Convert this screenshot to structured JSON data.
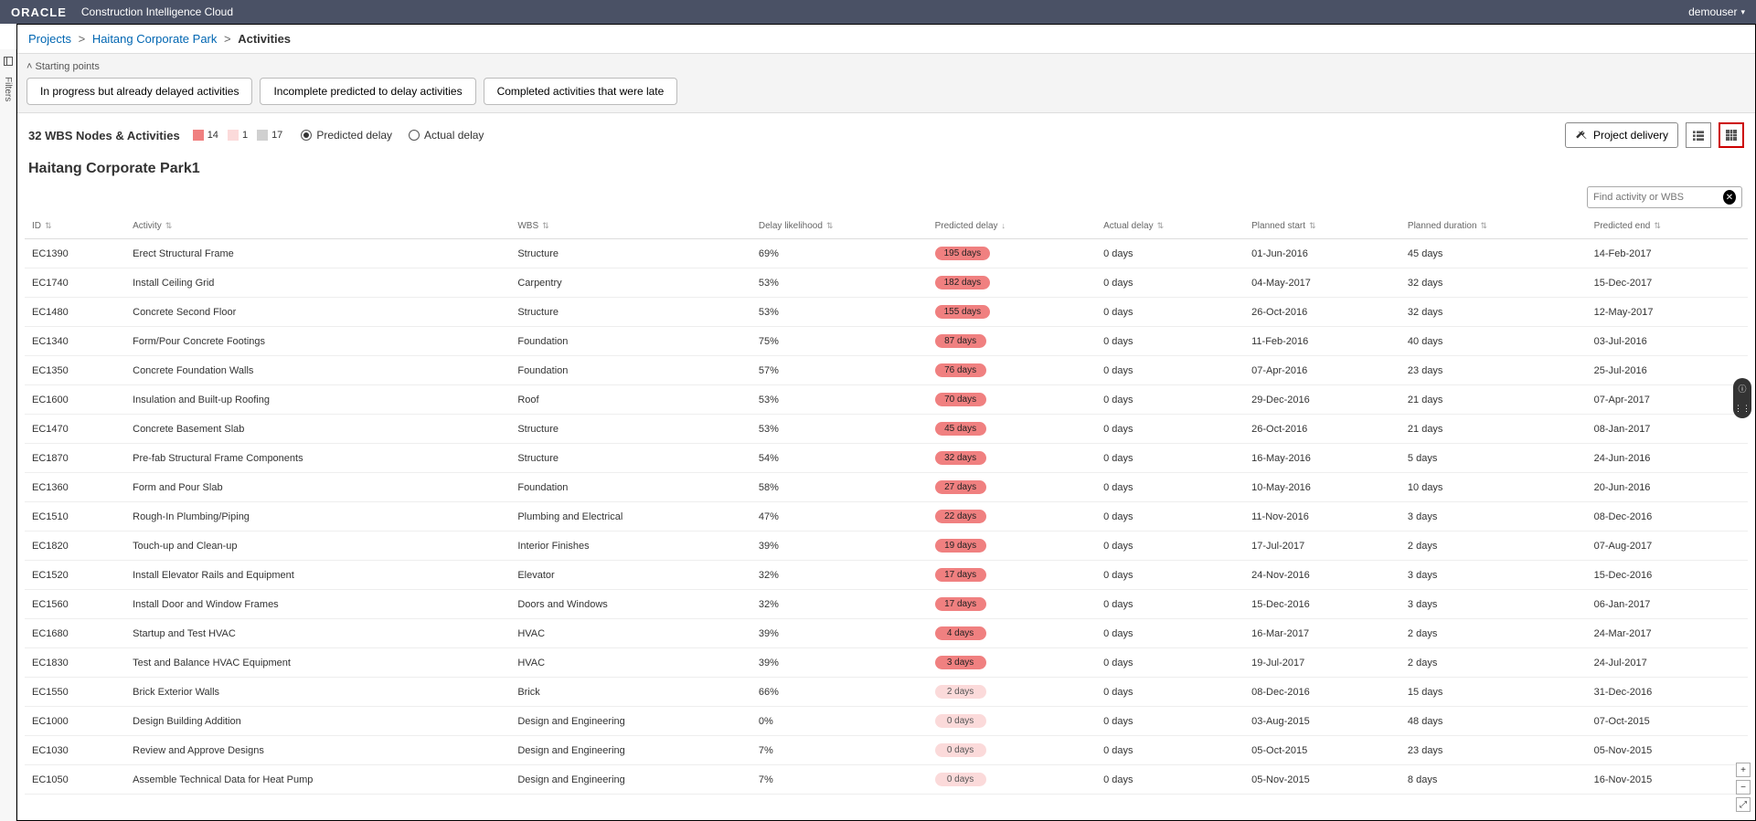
{
  "header": {
    "logo": "ORACLE",
    "app": "Construction Intelligence Cloud",
    "user": "demouser"
  },
  "breadcrumb": {
    "root": "Projects",
    "project": "Haitang Corporate Park",
    "current": "Activities"
  },
  "filters_label": "Filters",
  "starting": {
    "label": "Starting points",
    "chips": {
      "a": "In progress but already delayed activities",
      "b": "Incomplete predicted to delay activities",
      "c": "Completed activities that were late"
    }
  },
  "summary": {
    "title": "32 WBS Nodes & Activities",
    "counts": {
      "red": "14",
      "pink": "1",
      "grey": "17"
    },
    "radios": {
      "predicted": "Predicted delay",
      "actual": "Actual delay"
    },
    "project_delivery": "Project delivery"
  },
  "project_title": "Haitang Corporate Park1",
  "search": {
    "placeholder": "Find activity or WBS"
  },
  "columns": {
    "id": "ID",
    "activity": "Activity",
    "wbs": "WBS",
    "likelihood": "Delay likelihood",
    "predicted": "Predicted delay",
    "actual": "Actual delay",
    "start": "Planned start",
    "duration": "Planned duration",
    "end": "Predicted end"
  },
  "rows": [
    {
      "id": "EC1390",
      "activity": "Erect Structural Frame",
      "wbs": "Structure",
      "likelihood": "69%",
      "predicted": "195 days",
      "level": "high",
      "actual": "0 days",
      "start": "01-Jun-2016",
      "duration": "45 days",
      "end": "14-Feb-2017"
    },
    {
      "id": "EC1740",
      "activity": "Install Ceiling Grid",
      "wbs": "Carpentry",
      "likelihood": "53%",
      "predicted": "182 days",
      "level": "high",
      "actual": "0 days",
      "start": "04-May-2017",
      "duration": "32 days",
      "end": "15-Dec-2017"
    },
    {
      "id": "EC1480",
      "activity": "Concrete Second Floor",
      "wbs": "Structure",
      "likelihood": "53%",
      "predicted": "155 days",
      "level": "high",
      "actual": "0 days",
      "start": "26-Oct-2016",
      "duration": "32 days",
      "end": "12-May-2017"
    },
    {
      "id": "EC1340",
      "activity": "Form/Pour Concrete Footings",
      "wbs": "Foundation",
      "likelihood": "75%",
      "predicted": "87 days",
      "level": "high",
      "actual": "0 days",
      "start": "11-Feb-2016",
      "duration": "40 days",
      "end": "03-Jul-2016"
    },
    {
      "id": "EC1350",
      "activity": "Concrete Foundation Walls",
      "wbs": "Foundation",
      "likelihood": "57%",
      "predicted": "76 days",
      "level": "high",
      "actual": "0 days",
      "start": "07-Apr-2016",
      "duration": "23 days",
      "end": "25-Jul-2016"
    },
    {
      "id": "EC1600",
      "activity": "Insulation and Built-up Roofing",
      "wbs": "Roof",
      "likelihood": "53%",
      "predicted": "70 days",
      "level": "high",
      "actual": "0 days",
      "start": "29-Dec-2016",
      "duration": "21 days",
      "end": "07-Apr-2017"
    },
    {
      "id": "EC1470",
      "activity": "Concrete Basement Slab",
      "wbs": "Structure",
      "likelihood": "53%",
      "predicted": "45 days",
      "level": "high",
      "actual": "0 days",
      "start": "26-Oct-2016",
      "duration": "21 days",
      "end": "08-Jan-2017"
    },
    {
      "id": "EC1870",
      "activity": "Pre-fab Structural Frame Components",
      "wbs": "Structure",
      "likelihood": "54%",
      "predicted": "32 days",
      "level": "high",
      "actual": "0 days",
      "start": "16-May-2016",
      "duration": "5 days",
      "end": "24-Jun-2016"
    },
    {
      "id": "EC1360",
      "activity": "Form and Pour Slab",
      "wbs": "Foundation",
      "likelihood": "58%",
      "predicted": "27 days",
      "level": "high",
      "actual": "0 days",
      "start": "10-May-2016",
      "duration": "10 days",
      "end": "20-Jun-2016"
    },
    {
      "id": "EC1510",
      "activity": "Rough-In Plumbing/Piping",
      "wbs": "Plumbing and Electrical",
      "likelihood": "47%",
      "predicted": "22 days",
      "level": "high",
      "actual": "0 days",
      "start": "11-Nov-2016",
      "duration": "3 days",
      "end": "08-Dec-2016"
    },
    {
      "id": "EC1820",
      "activity": "Touch-up and Clean-up",
      "wbs": "Interior Finishes",
      "likelihood": "39%",
      "predicted": "19 days",
      "level": "high",
      "actual": "0 days",
      "start": "17-Jul-2017",
      "duration": "2 days",
      "end": "07-Aug-2017"
    },
    {
      "id": "EC1520",
      "activity": "Install Elevator Rails and Equipment",
      "wbs": "Elevator",
      "likelihood": "32%",
      "predicted": "17 days",
      "level": "high",
      "actual": "0 days",
      "start": "24-Nov-2016",
      "duration": "3 days",
      "end": "15-Dec-2016"
    },
    {
      "id": "EC1560",
      "activity": "Install Door and Window Frames",
      "wbs": "Doors and Windows",
      "likelihood": "32%",
      "predicted": "17 days",
      "level": "high",
      "actual": "0 days",
      "start": "15-Dec-2016",
      "duration": "3 days",
      "end": "06-Jan-2017"
    },
    {
      "id": "EC1680",
      "activity": "Startup and Test HVAC",
      "wbs": "HVAC",
      "likelihood": "39%",
      "predicted": "4 days",
      "level": "high",
      "actual": "0 days",
      "start": "16-Mar-2017",
      "duration": "2 days",
      "end": "24-Mar-2017"
    },
    {
      "id": "EC1830",
      "activity": "Test and Balance HVAC Equipment",
      "wbs": "HVAC",
      "likelihood": "39%",
      "predicted": "3 days",
      "level": "high",
      "actual": "0 days",
      "start": "19-Jul-2017",
      "duration": "2 days",
      "end": "24-Jul-2017"
    },
    {
      "id": "EC1550",
      "activity": "Brick Exterior Walls",
      "wbs": "Brick",
      "likelihood": "66%",
      "predicted": "2 days",
      "level": "low",
      "actual": "0 days",
      "start": "08-Dec-2016",
      "duration": "15 days",
      "end": "31-Dec-2016"
    },
    {
      "id": "EC1000",
      "activity": "Design Building Addition",
      "wbs": "Design and Engineering",
      "likelihood": "0%",
      "predicted": "0 days",
      "level": "low",
      "actual": "0 days",
      "start": "03-Aug-2015",
      "duration": "48 days",
      "end": "07-Oct-2015"
    },
    {
      "id": "EC1030",
      "activity": "Review and Approve Designs",
      "wbs": "Design and Engineering",
      "likelihood": "7%",
      "predicted": "0 days",
      "level": "low",
      "actual": "0 days",
      "start": "05-Oct-2015",
      "duration": "23 days",
      "end": "05-Nov-2015"
    },
    {
      "id": "EC1050",
      "activity": "Assemble Technical Data for Heat Pump",
      "wbs": "Design and Engineering",
      "likelihood": "7%",
      "predicted": "0 days",
      "level": "low",
      "actual": "0 days",
      "start": "05-Nov-2015",
      "duration": "8 days",
      "end": "16-Nov-2015"
    }
  ]
}
